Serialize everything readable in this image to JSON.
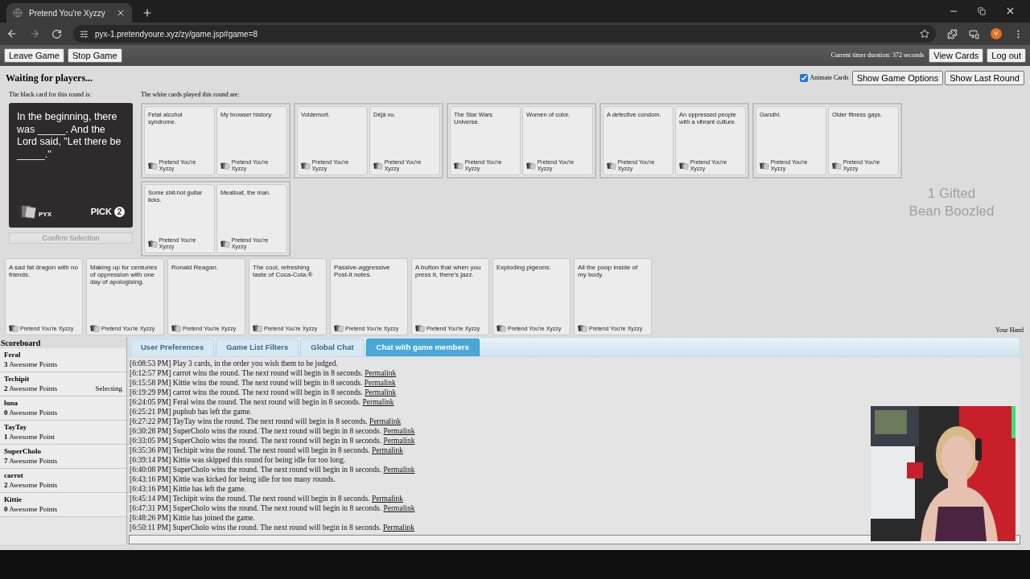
{
  "browser": {
    "tab_title": "Pretend You're Xyzzy",
    "url": "pyx-1.pretendyoure.xyz/zy/game.jsp#game=8",
    "profile_initial": "V"
  },
  "toolbar": {
    "left_buttons": [
      "Leave Game",
      "Stop Game"
    ],
    "timer": "Current timer duration: 372 seconds",
    "right_buttons": [
      "View Cards",
      "Log out"
    ]
  },
  "status": "Waiting for players...",
  "animate_cards": {
    "label": "Animate Cards",
    "checked": true
  },
  "option_buttons": [
    "Show Game Options",
    "Show Last Round"
  ],
  "black_card": {
    "label": "The black card for this round is:",
    "text": "In the beginning, there was _____. And the Lord said, \"Let there be _____.\"",
    "brand": "PYX",
    "pick_label": "PICK",
    "pick_count": "2"
  },
  "confirm_button": {
    "label": "Confirm Selection",
    "disabled": true
  },
  "played": {
    "label": "The white cards played this round are:",
    "groups": [
      {
        "cards": [
          {
            "text": "Fetal alcohol syndrome.",
            "footer": "Pretend You're Xyzzy"
          },
          {
            "text": "My browser history.",
            "footer": "Pretend You're Xyzzy"
          }
        ]
      },
      {
        "cards": [
          {
            "text": "Voldemort.",
            "footer": "Pretend You're Xyzzy"
          },
          {
            "text": "Déjà vu.",
            "footer": "Pretend You're Xyzzy"
          }
        ]
      },
      {
        "cards": [
          {
            "text": "The Star Wars Universe.",
            "footer": "Pretend You're Xyzzy"
          },
          {
            "text": "Women of color.",
            "footer": "Pretend You're Xyzzy"
          }
        ]
      },
      {
        "cards": [
          {
            "text": "A defective condom.",
            "footer": "Pretend You're Xyzzy"
          },
          {
            "text": "An oppressed people with a vibrant culture.",
            "footer": "Pretend You're Xyzzy"
          }
        ]
      },
      {
        "cards": [
          {
            "text": "Gandhi.",
            "footer": "Pretend You're Xyzzy"
          },
          {
            "text": "Older fitness gays.",
            "footer": "Pretend You're Xyzzy"
          }
        ]
      },
      {
        "cards": [
          {
            "text": "Some shit-hot guitar licks.",
            "footer": "Pretend You're Xyzzy"
          },
          {
            "text": "Meatloaf, the man.",
            "footer": "Pretend You're Xyzzy"
          }
        ]
      }
    ]
  },
  "overlay_text": [
    "1 Gifted",
    "Bean Boozled"
  ],
  "hand": {
    "label": "Your Hand",
    "cards": [
      {
        "text": "A sad fat dragon with no friends.",
        "footer": "Pretend You're Xyzzy"
      },
      {
        "text": "Making up for centuries of oppression with one day of apologising.",
        "footer": "Pretend You're Xyzzy"
      },
      {
        "text": "Ronald Reagan.",
        "footer": "Pretend You're Xyzzy"
      },
      {
        "text": "The cool, refreshing taste of Coca-Cola.®",
        "footer": "Pretend You're Xyzzy"
      },
      {
        "text": "Passive-aggressive Post-it notes.",
        "footer": "Pretend You're Xyzzy"
      },
      {
        "text": "A button that when you press it, there's jazz.",
        "footer": "Pretend You're Xyzzy"
      },
      {
        "text": "Exploding pigeons.",
        "footer": "Pretend You're Xyzzy"
      },
      {
        "text": "All the poop inside of my body.",
        "footer": "Pretend You're Xyzzy"
      }
    ]
  },
  "scoreboard": {
    "title": "Scoreboard",
    "players": [
      {
        "name": "Feral",
        "points": "**3** Awesome Points"
      },
      {
        "name": "Techipit",
        "points": "**2** Awesome Points",
        "status": "Selecting"
      },
      {
        "name": "luna",
        "points": "**0** Awesome Points"
      },
      {
        "name": "TayTay",
        "points": "**1** Awesome Point"
      },
      {
        "name": "SuperCholo",
        "points": "**7** Awesome Points"
      },
      {
        "name": "carrot",
        "points": "**2** Awesome Points"
      },
      {
        "name": "Kittie",
        "points": "**0** Awesome Points"
      }
    ]
  },
  "tabs": [
    {
      "label": "User Preferences",
      "selected": false
    },
    {
      "label": "Game List Filters",
      "selected": false
    },
    {
      "label": "Global Chat",
      "selected": false
    },
    {
      "label": "Chat with game members",
      "selected": true
    }
  ],
  "chat": [
    {
      "time": "[6:08:53 PM]",
      "text": "Play 3 cards, in the order you wish them to be judged."
    },
    {
      "time": "[6:12:57 PM]",
      "text": "carrot wins the round. The next round will begin in 8 seconds.",
      "link": "Permalink"
    },
    {
      "time": "[6:15:58 PM]",
      "text": "Kittie wins the round. The next round will begin in 8 seconds.",
      "link": "Permalink"
    },
    {
      "time": "[6:19:29 PM]",
      "text": "carrot wins the round. The next round will begin in 8 seconds.",
      "link": "Permalink"
    },
    {
      "time": "[6:24:05 PM]",
      "text": "Feral wins the round. The next round will begin in 8 seconds.",
      "link": "Permalink"
    },
    {
      "time": "[6:25:21 PM]",
      "text": "puphub has left the game."
    },
    {
      "time": "[6:27:22 PM]",
      "text": "TayTay wins the round. The next round will begin in 8 seconds.",
      "link": "Permalink"
    },
    {
      "time": "[6:30:28 PM]",
      "text": "SuperCholo wins the round. The next round will begin in 8 seconds.",
      "link": "Permalink"
    },
    {
      "time": "[6:33:05 PM]",
      "text": "SuperCholo wins the round. The next round will begin in 8 seconds.",
      "link": "Permalink"
    },
    {
      "time": "[6:35:36 PM]",
      "text": "Techipit wins the round. The next round will begin in 8 seconds.",
      "link": "Permalink"
    },
    {
      "time": "[6:39:14 PM]",
      "text": "Kittie was skipped this round for being idle for too long."
    },
    {
      "time": "[6:40:08 PM]",
      "text": "SuperCholo wins the round. The next round will begin in 8 seconds.",
      "link": "Permalink"
    },
    {
      "time": "[6:43:16 PM]",
      "text": "Kittie was kicked for being idle for too many rounds."
    },
    {
      "time": "[6:43:16 PM]",
      "text": "Kittie has left the game."
    },
    {
      "time": "[6:45:14 PM]",
      "text": "Techipit wins the round. The next round will begin in 8 seconds.",
      "link": "Permalink"
    },
    {
      "time": "[6:47:31 PM]",
      "text": "SuperCholo wins the round. The next round will begin in 8 seconds.",
      "link": "Permalink"
    },
    {
      "time": "[6:48:26 PM]",
      "text": "Kittie has joined the game."
    },
    {
      "time": "[6:50:11 PM]",
      "text": "SuperCholo wins the round. The next round will begin in 8 seconds.",
      "link": "Permalink"
    }
  ]
}
